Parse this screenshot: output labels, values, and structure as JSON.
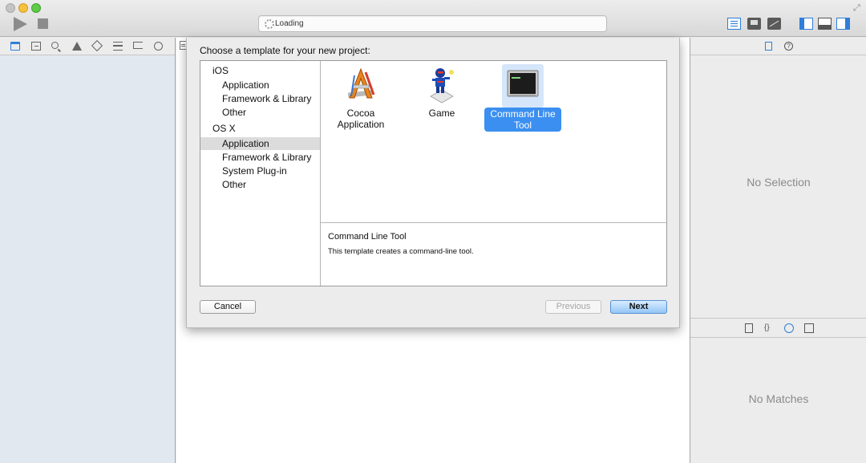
{
  "toolbar": {
    "activity_text": "Loading"
  },
  "sheet": {
    "title": "Choose a template for your new project:",
    "categories": [
      {
        "header": "iOS",
        "items": [
          "Application",
          "Framework & Library",
          "Other"
        ]
      },
      {
        "header": "OS X",
        "items": [
          "Application",
          "Framework & Library",
          "System Plug-in",
          "Other"
        ]
      }
    ],
    "selected_category": "OS X / Application",
    "templates": [
      {
        "label_line1": "Cocoa",
        "label_line2": "Application",
        "icon": "cocoa-app-icon"
      },
      {
        "label_line1": "Game",
        "label_line2": "",
        "icon": "game-icon"
      },
      {
        "label_line1": "Command Line",
        "label_line2": "Tool",
        "icon": "terminal-icon",
        "selected": true
      }
    ],
    "description": {
      "title": "Command Line Tool",
      "text": "This template creates a command-line tool."
    },
    "buttons": {
      "cancel": "Cancel",
      "previous": "Previous",
      "next": "Next"
    }
  },
  "utilities": {
    "no_selection": "No Selection",
    "no_matches": "No Matches"
  },
  "colors": {
    "accent": "#3b8ff0",
    "selection_bg": "#dcdcdc",
    "navigator_bg": "#e2e8ef"
  }
}
